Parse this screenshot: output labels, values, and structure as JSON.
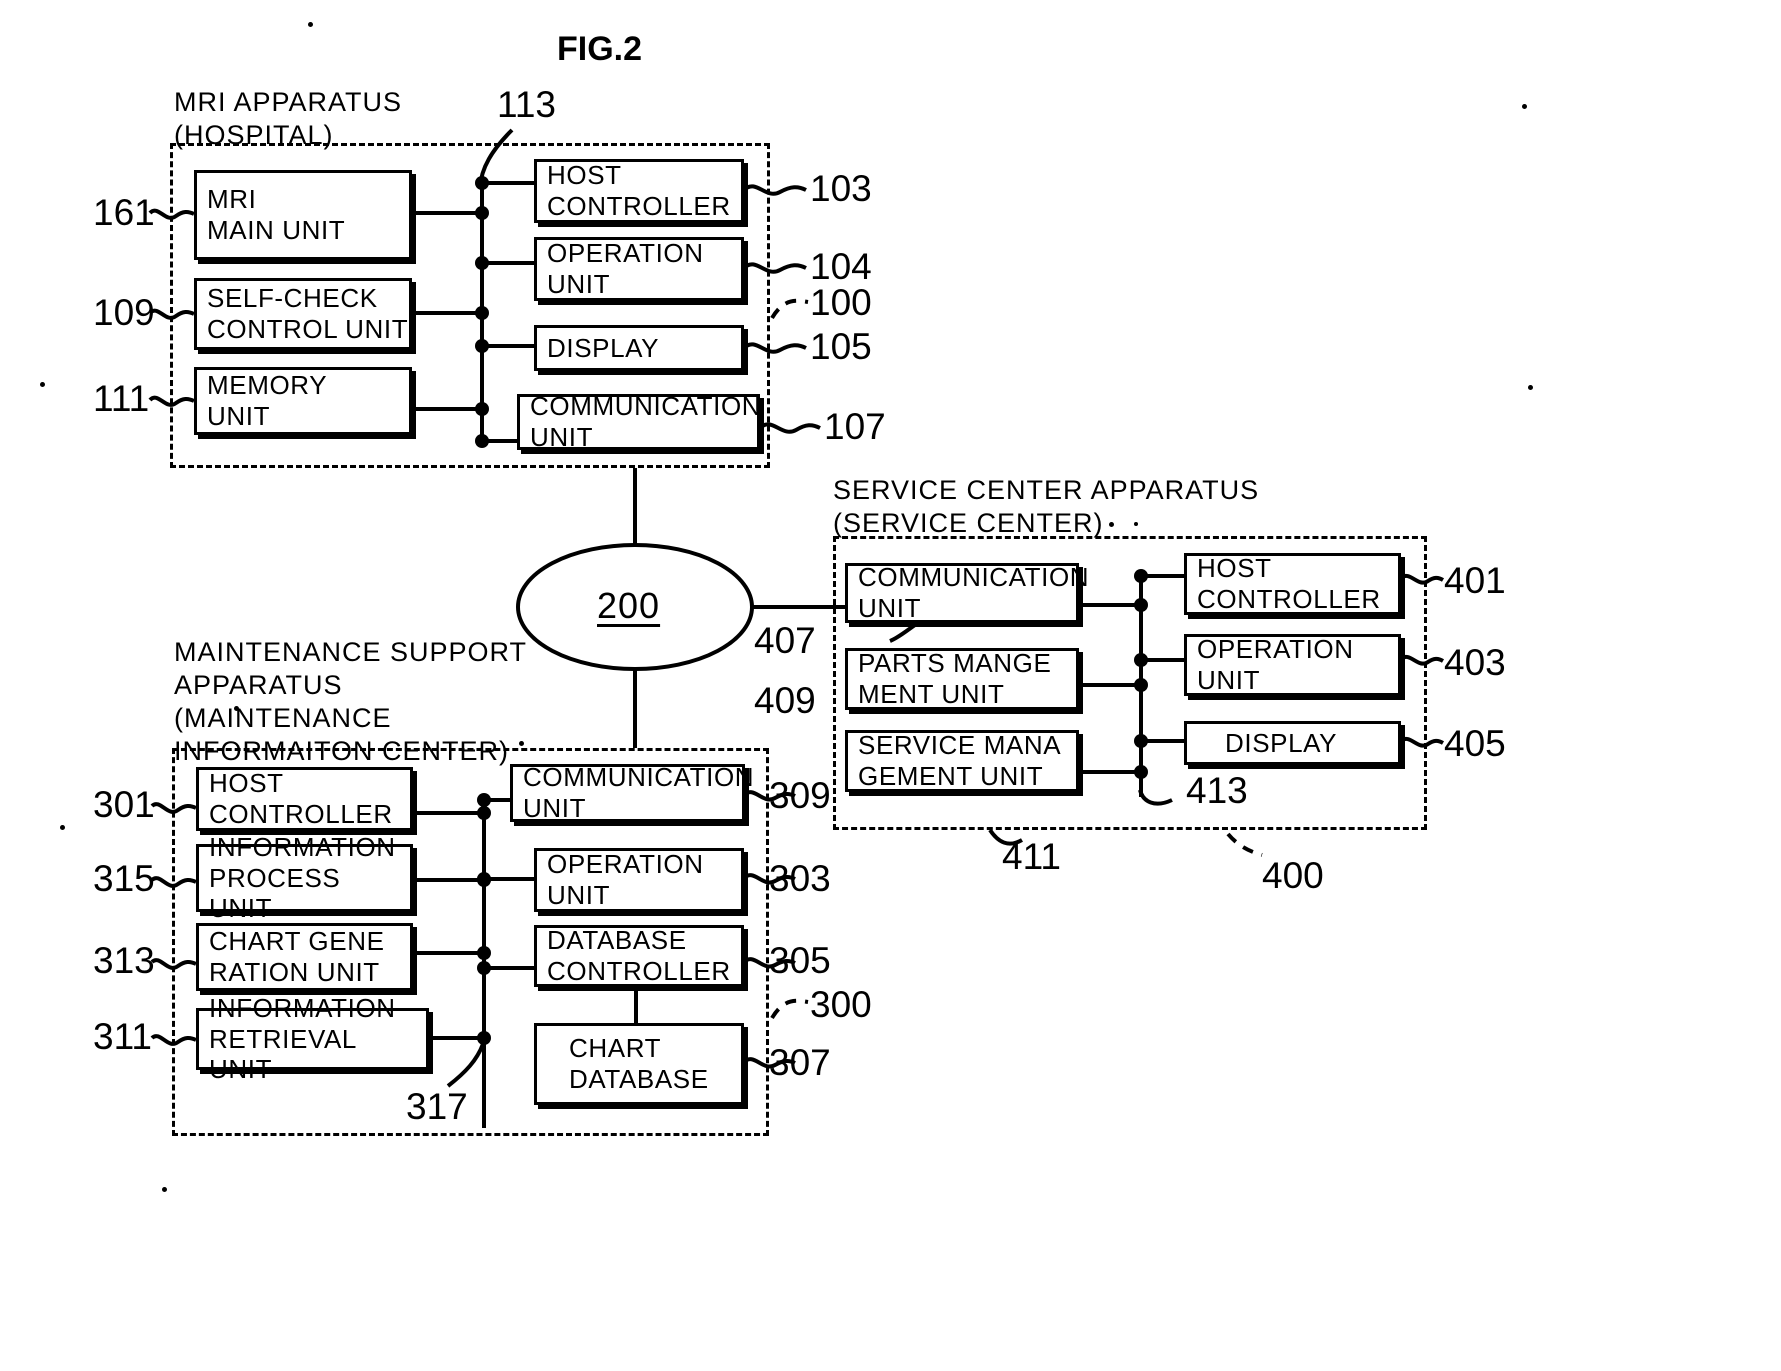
{
  "figure": {
    "title": "FIG.2"
  },
  "groups": {
    "mri": {
      "label": "MRI APPARATUS\n(HOSPITAL)",
      "ref": "100"
    },
    "maintenance": {
      "label": "MAINTENANCE SUPPORT\nAPPARATUS\n(MAINTENANCE\nINFORMAITON CENTER)",
      "ref": "300"
    },
    "service_center": {
      "label": "SERVICE CENTER APPARATUS\n(SERVICE CENTER)",
      "ref": "400"
    }
  },
  "network": {
    "label": "200"
  },
  "mri_blocks": [
    {
      "id": "mri-main-unit",
      "label": "MRI\nMAIN UNIT",
      "ref": "161"
    },
    {
      "id": "self-check-control-unit",
      "label": "SELF-CHECK\nCONTROL UNIT",
      "ref": "109"
    },
    {
      "id": "memory-unit",
      "label": "MEMORY\nUNIT",
      "ref": "111"
    },
    {
      "id": "host-controller",
      "label": "HOST\nCONTROLLER",
      "ref": "103"
    },
    {
      "id": "operation-unit",
      "label": "OPERATION\nUNIT",
      "ref": "104"
    },
    {
      "id": "display",
      "label": "DISPLAY",
      "ref": "105"
    },
    {
      "id": "communication-unit",
      "label": "COMMUNICATION\nUNIT",
      "ref": "107"
    }
  ],
  "mri_bus_ref": "113",
  "maintenance_blocks": [
    {
      "id": "host-controller",
      "label": "HOST\nCONTROLLER",
      "ref": "301"
    },
    {
      "id": "information-process-unit",
      "label": "INFORMATION\nPROCESS UNIT",
      "ref": "315"
    },
    {
      "id": "chart-generation-unit",
      "label": "CHART GENE\nRATION UNIT",
      "ref": "313"
    },
    {
      "id": "information-retrieval-unit",
      "label": "INFORMATION\nRETRIEVAL UNIT",
      "ref": "311"
    },
    {
      "id": "communication-unit",
      "label": "COMMUNICATION\nUNIT",
      "ref": "309"
    },
    {
      "id": "operation-unit",
      "label": "OPERATION\nUNIT",
      "ref": "303"
    },
    {
      "id": "database-controller",
      "label": "DATABASE\nCONTROLLER",
      "ref": "305"
    },
    {
      "id": "chart-database",
      "label": "CHART\nDATABASE",
      "ref": "307"
    }
  ],
  "maintenance_bus_ref": "317",
  "service_blocks": [
    {
      "id": "communication-unit",
      "label": "COMMUNICATION\nUNIT",
      "ref": "407"
    },
    {
      "id": "parts-management-unit",
      "label": "PARTS MANGE\nMENT UNIT",
      "ref": "409"
    },
    {
      "id": "service-management-unit",
      "label": "SERVICE MANA\nGEMENT UNIT",
      "ref": "411"
    },
    {
      "id": "host-controller",
      "label": "HOST\nCONTROLLER",
      "ref": "401"
    },
    {
      "id": "operation-unit",
      "label": "OPERATION\nUNIT",
      "ref": "403"
    },
    {
      "id": "display",
      "label": "DISPLAY",
      "ref": "405"
    }
  ],
  "service_bus_ref": "413",
  "colors": {
    "line": "#000000",
    "background": "#ffffff"
  }
}
